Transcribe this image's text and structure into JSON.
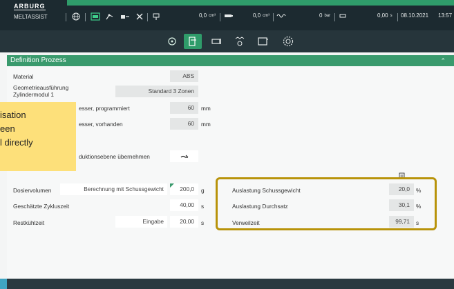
{
  "header": {
    "logo": "ARBURG",
    "app_name": "MELTASSIST",
    "status": {
      "volume1": "0,0",
      "volume1_unit": "cm³",
      "volume2": "0,0",
      "volume2_unit": "cm³",
      "pressure": "0",
      "pressure_unit": "bar",
      "time": "0,00",
      "time_unit": "s",
      "date": "08.10.2021",
      "clock": "13:57"
    }
  },
  "section": {
    "title": "Definition Prozess"
  },
  "rows": {
    "material": {
      "label": "Material",
      "value": "ABS"
    },
    "geometry": {
      "label_line1": "Geometrieausführung",
      "label_line2": "Zylindermodul 1",
      "value": "Standard 3 Zonen"
    },
    "screw_programmed": {
      "label": "Schneckendurchmesser, programmiert",
      "label_visible": "esser, programmiert",
      "value": "60",
      "unit": "mm"
    },
    "screw_present": {
      "label_visible": "esser, vorhanden",
      "value": "60",
      "unit": "mm"
    },
    "production_level": {
      "label_visible": "duktionsebene übernehmen"
    },
    "dosing": {
      "label": "Dosiervolumen",
      "calc_button": "Berechnung mit Schussgewicht",
      "value": "200,0",
      "unit": "g"
    },
    "cycle_time": {
      "label": "Geschätzte Zykluszeit",
      "value": "40,00",
      "unit": "s"
    },
    "cooling": {
      "label": "Restkühlzeit",
      "input_button": "Eingabe",
      "value": "20,00",
      "unit": "s"
    }
  },
  "results": {
    "shot_weight": {
      "label": "Auslastung Schussgewicht",
      "value": "20,0",
      "unit": "%"
    },
    "throughput": {
      "label": "Auslastung Durchsatz",
      "value": "30,1",
      "unit": "%"
    },
    "residence": {
      "label": "Verweilzeit",
      "value": "99,71",
      "unit": "s"
    }
  },
  "tooltip": {
    "line1": "isation",
    "line2": "een",
    "line3": "l directly"
  },
  "colors": {
    "accent_green": "#3a9a6d",
    "highlight": "#b8930a",
    "tooltip": "#fde07a",
    "topbar": "#1c2a30"
  }
}
